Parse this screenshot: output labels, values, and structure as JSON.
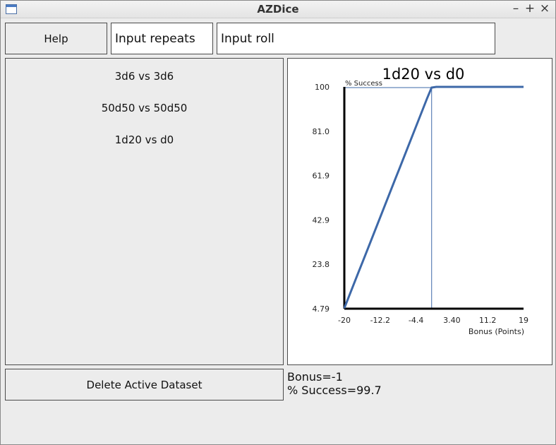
{
  "window": {
    "title": "AZDice",
    "controls": {
      "minimize": "–",
      "maximize": "+",
      "close": "×"
    }
  },
  "toolbar": {
    "help_label": "Help",
    "repeats_value": "Input repeats",
    "roll_value": "Input roll"
  },
  "datasets": [
    "3d6 vs 3d6",
    "50d50 vs 50d50",
    "1d20 vs d0"
  ],
  "delete_label": "Delete Active Dataset",
  "status": {
    "bonus": "Bonus=-1",
    "success": "% Success=99.7"
  },
  "chart_data": {
    "type": "line",
    "title": "1d20 vs d0",
    "xlabel": "Bonus (Points)",
    "ylabel": "% Success",
    "xlim": [
      -20,
      19
    ],
    "ylim": [
      4.79,
      100
    ],
    "xticks": [
      "-20",
      "-12.2",
      "-4.4",
      "3.40",
      "11.2",
      "19"
    ],
    "yticks": [
      "4.79",
      "23.8",
      "42.9",
      "61.9",
      "81.0",
      "100"
    ],
    "series": [
      {
        "x": [
          -20,
          -19,
          -18,
          -17,
          -16,
          -15,
          -14,
          -13,
          -12,
          -11,
          -10,
          -9,
          -8,
          -7,
          -6,
          -5,
          -4,
          -3,
          -2,
          -1,
          0,
          1,
          2,
          3,
          4,
          5,
          6,
          7,
          8,
          9,
          10,
          11,
          12,
          13,
          14,
          15,
          16,
          17,
          18,
          19
        ],
        "y": [
          5,
          10,
          15,
          20,
          25,
          30,
          35,
          40,
          45,
          50,
          55,
          60,
          65,
          70,
          75,
          80,
          85,
          90,
          95,
          99.7,
          100,
          100,
          100,
          100,
          100,
          100,
          100,
          100,
          100,
          100,
          100,
          100,
          100,
          100,
          100,
          100,
          100,
          100,
          100,
          100
        ]
      }
    ],
    "marker": {
      "x": -1,
      "y": 99.7
    },
    "accent": "#3d68a8"
  }
}
